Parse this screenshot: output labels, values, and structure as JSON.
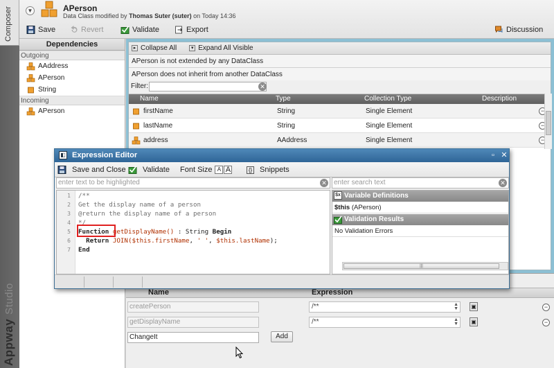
{
  "sidebar": {
    "composer_tab": "Composer",
    "brand_word1": "Appway",
    "brand_word2": "Studio"
  },
  "header": {
    "title": "APerson",
    "subtitle_prefix": "Data Class modified by",
    "subtitle_user": "Thomas Suter (suter)",
    "subtitle_suffix": "on Today 14:36",
    "toolbar": {
      "save": "Save",
      "revert": "Revert",
      "validate": "Validate",
      "export": "Export",
      "discussion": "Discussion"
    }
  },
  "dependencies": {
    "title": "Dependencies",
    "outgoing_label": "Outgoing",
    "outgoing": [
      "AAddress",
      "APerson",
      "String"
    ],
    "incoming_label": "Incoming",
    "incoming": [
      "APerson"
    ]
  },
  "main": {
    "collapse_all": "Collapse All",
    "expand_all": "Expand All Visible",
    "info1": "APerson is not extended by any DataClass",
    "info2": "APerson does not inherit from another DataClass",
    "filter_label": "Filter:",
    "columns": [
      "Name",
      "Type",
      "Collection Type",
      "Description"
    ],
    "rows": [
      {
        "name": "firstName",
        "type": "String",
        "collection": "Single Element"
      },
      {
        "name": "lastName",
        "type": "String",
        "collection": "Single Element"
      },
      {
        "name": "address",
        "type": "AAddress",
        "collection": "Single Element"
      }
    ]
  },
  "methods": {
    "col_name": "Name",
    "col_expression": "Expression",
    "rows": [
      {
        "name": "createPerson",
        "expression": "/**"
      },
      {
        "name": "getDisplayName",
        "expression": "/**"
      }
    ],
    "new_name": "ChangeIt",
    "add_label": "Add"
  },
  "editor": {
    "title": "Expression Editor",
    "save_close": "Save and Close",
    "validate": "Validate",
    "font_size": "Font Size",
    "snippets": "Snippets",
    "highlight_placeholder": "enter text to be highlighted",
    "search_placeholder": "enter search text",
    "line_numbers": [
      "1",
      "2",
      "3",
      "4",
      "5",
      "6",
      "7"
    ],
    "code": {
      "l1": "/**",
      "l2": "Get the display name of a person",
      "l3": "@return the display name of a person",
      "l4": "*/",
      "l5_kw1": "Function",
      "l5_fn": "getDisplayName()",
      "l5_rest": " : String ",
      "l5_kw2": "Begin",
      "l6_kw": "Return",
      "l6_fn": "JOIN(",
      "l6_var1": "$this.firstName",
      "l6_sep": ", ",
      "l6_str": "' '",
      "l6_sep2": ", ",
      "l6_var2": "$this.lastName",
      "l6_end": ");",
      "l7_kw": "End"
    },
    "var_defs_title": "Variable Definitions",
    "var_def_name": "$this",
    "var_def_type": "(APerson)",
    "validation_title": "Validation Results",
    "validation_text": "No Validation Errors",
    "font_a_small": "A",
    "font_a_big": "A",
    "scroll_grip": "|||"
  },
  "colors": {
    "title_bar": "#2f6597",
    "accent_blue": "#8cc0d4",
    "highlight_box": "#e02020"
  }
}
